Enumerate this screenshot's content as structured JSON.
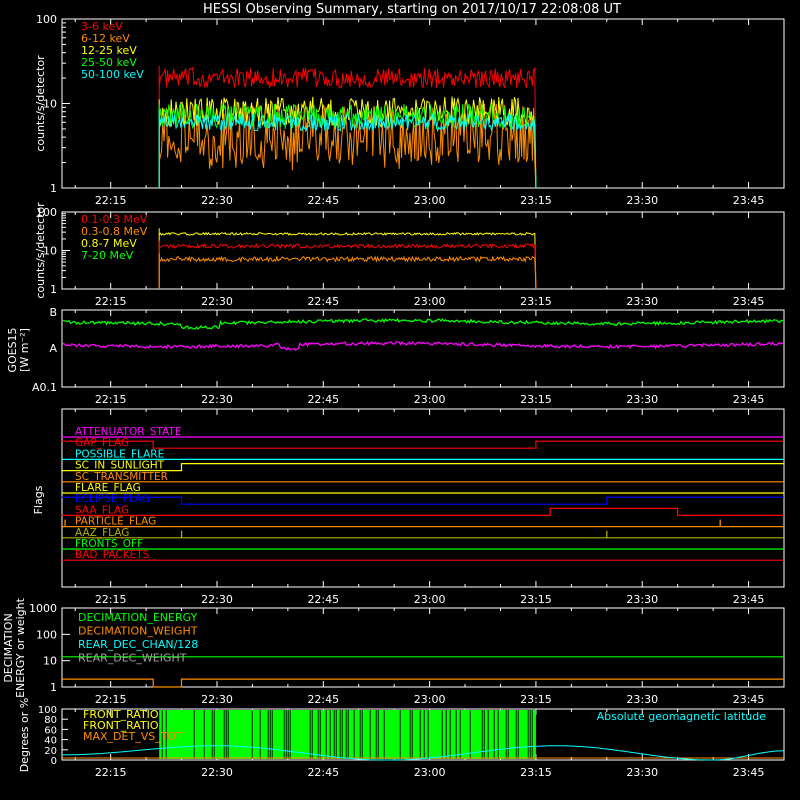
{
  "title": "HESSI Observing Summary, starting on 2017/10/17 22:08:08 UT",
  "time_axis": {
    "start": "22:08",
    "end": "23:50",
    "tick_labels": [
      "22:15",
      "22:30",
      "22:45",
      "23:00",
      "23:15",
      "23:30",
      "23:45"
    ]
  },
  "colors": {
    "background": "#000000",
    "axis": "#ffffff",
    "red": "#ff0000",
    "orange": "#ff8c00",
    "yellow": "#ffff00",
    "green": "#00ff00",
    "cyan": "#00ffff",
    "magenta": "#ff00ff",
    "blue": "#0000ff",
    "olive": "#b0b000",
    "salmon": "#ff6060",
    "gray": "#a0a0a0"
  },
  "chart_data": [
    {
      "id": "lightcurve_low",
      "type": "line",
      "ylabel": "counts/s/detector",
      "yscale": "log",
      "ylim": [
        1,
        100
      ],
      "ytick_labels": [
        "1",
        "10",
        "100"
      ],
      "data_window": [
        "22:21",
        "23:15"
      ],
      "grid": false,
      "legend_placement": "top-left",
      "series": [
        {
          "name": "3-6 keV",
          "color": "red",
          "level": 20,
          "noise": 0.12
        },
        {
          "name": "6-12 keV",
          "color": "orange",
          "level": 4.5,
          "noise": 0.35
        },
        {
          "name": "12-25 keV",
          "color": "yellow",
          "level": 8,
          "noise": 0.18
        },
        {
          "name": "25-50 keV",
          "color": "green",
          "level": 7,
          "noise": 0.15
        },
        {
          "name": "50-100 keV",
          "color": "cyan",
          "level": 6,
          "noise": 0.1
        }
      ]
    },
    {
      "id": "lightcurve_high",
      "type": "line",
      "ylabel": "counts/s/detector",
      "yscale": "log",
      "ylim": [
        1,
        100
      ],
      "ytick_labels": [
        "1",
        "10",
        "100"
      ],
      "data_window": [
        "22:21",
        "23:15"
      ],
      "grid": false,
      "legend_placement": "top-left",
      "series": [
        {
          "name": "0.1-0.3 MeV",
          "color": "red",
          "level": 13,
          "noise": 0.05
        },
        {
          "name": "0.3-0.8 MeV",
          "color": "orange",
          "level": 6,
          "noise": 0.06
        },
        {
          "name": "0.8-7 MeV",
          "color": "yellow",
          "level": 27,
          "noise": 0.03
        },
        {
          "name": "7-20 MeV",
          "color": "green",
          "level": 0,
          "noise": 0
        }
      ]
    },
    {
      "id": "goes",
      "type": "line",
      "ylabel": "GOES15",
      "ylabel2": "[W m⁻²]",
      "yscale": "log",
      "ytick_labels": [
        "B",
        "A",
        "A0.1"
      ],
      "series": [
        {
          "color": "green",
          "level": 1.55e-07
        },
        {
          "color": "magenta",
          "level": 9e-08
        }
      ]
    },
    {
      "id": "flags",
      "type": "step",
      "ylabel": "Flags",
      "series": [
        {
          "name": "ATTENUATOR_STATE",
          "color": "magenta",
          "steps": []
        },
        {
          "name": "SAA_FLAG_TOP",
          "label": "GAP_FLAG",
          "color": "red",
          "steps": [
            [
              "22:08",
              "22:21",
              1
            ],
            [
              "22:21",
              "23:15",
              0
            ],
            [
              "23:15",
              "23:50",
              1
            ]
          ]
        },
        {
          "name": "POSSIBLE_FLARE",
          "color": "cyan",
          "steps": []
        },
        {
          "name": "SC_IN_SUNLIGHT",
          "color": "yellow",
          "steps": [
            [
              "22:08",
              "22:25",
              0
            ],
            [
              "22:25",
              "23:50",
              1
            ]
          ]
        },
        {
          "name": "SC_TRANSMITTER",
          "color": "orange",
          "steps": []
        },
        {
          "name": "FLARE_FLAG",
          "color": "yellow",
          "steps": []
        },
        {
          "name": "ECLIPSE_FLAG",
          "color": "blue",
          "steps": [
            [
              "22:08",
              "22:25",
              1
            ],
            [
              "22:25",
              "23:25",
              0
            ],
            [
              "23:25",
              "23:50",
              1
            ]
          ]
        },
        {
          "name": "SAA_FLAG",
          "color": "red",
          "steps": [
            [
              "22:08",
              "23:17",
              0
            ],
            [
              "23:17",
              "23:35",
              1
            ],
            [
              "23:35",
              "23:50",
              0
            ]
          ]
        },
        {
          "name": "PARTICLE_FLAG",
          "color": "orange",
          "steps": [],
          "spikes": [
            "22:08",
            "23:41"
          ]
        },
        {
          "name": "AAZ_FLAG",
          "color": "olive",
          "steps": [],
          "spikes": [
            "22:25",
            "23:25"
          ]
        },
        {
          "name": "FRONTS_OFF",
          "color": "green",
          "steps": []
        },
        {
          "name": "BAD_PACKETS",
          "color": "red",
          "steps": []
        }
      ]
    },
    {
      "id": "decimation",
      "type": "step",
      "ylabel": "DECIMATION",
      "ylabel2": "ENERGY or weight",
      "yscale": "log",
      "ylim": [
        1,
        1000
      ],
      "ytick_labels": [
        "1",
        "10",
        "100",
        "1000"
      ],
      "legend_placement": "top-left",
      "series": [
        {
          "name": "DECIMATION_ENERGY",
          "color": "green",
          "steps": [
            [
              "22:08",
              "23:50",
              14
            ]
          ]
        },
        {
          "name": "DECIMATION_WEIGHT",
          "color": "orange",
          "steps": [
            [
              "22:08",
              "22:21",
              2
            ],
            [
              "22:21",
              "22:25",
              1
            ],
            [
              "22:25",
              "23:50",
              2
            ]
          ]
        },
        {
          "name": "REAR_DEC_CHAN/128",
          "color": "cyan",
          "steps": []
        },
        {
          "name": "REAR_DEC_WEIGHT",
          "color": "gray",
          "steps": []
        }
      ]
    },
    {
      "id": "ratios",
      "type": "line",
      "ylabel": "Degrees or %",
      "ylim": [
        0,
        100
      ],
      "ytick_labels": [
        "0",
        "20",
        "40",
        "60",
        "80",
        "100"
      ],
      "legend_placement": "top-left",
      "series": [
        {
          "name": "FRONT_RATIO",
          "color": "green",
          "window": [
            "22:21",
            "23:15"
          ]
        },
        {
          "name": "FRONT_RATIO",
          "label_suffix": "",
          "color": "yellow"
        },
        {
          "name": "MAX_DET_VS_TOT",
          "color": "orange"
        },
        {
          "name": "Absolute geomagnetic latitude",
          "color": "cyan",
          "points": [
            [
              "22:08",
              10
            ],
            [
              "22:30",
              28
            ],
            [
              "22:54",
              0
            ],
            [
              "23:18",
              28
            ],
            [
              "23:40",
              0
            ],
            [
              "23:50",
              18
            ]
          ]
        }
      ]
    }
  ]
}
